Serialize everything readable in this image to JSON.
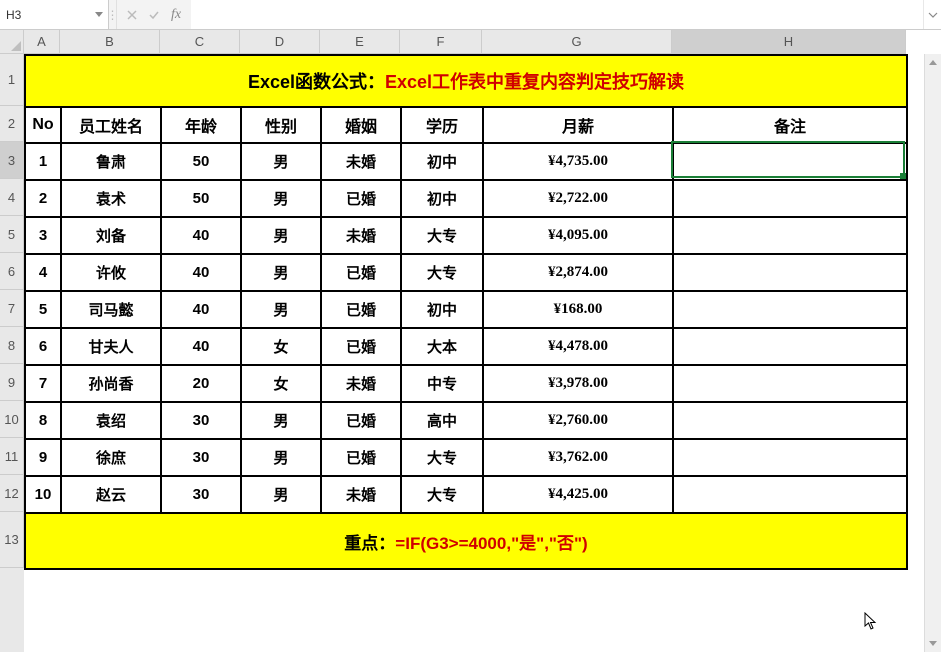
{
  "formula_bar": {
    "name_box": "H3",
    "formula": ""
  },
  "columns": [
    "A",
    "B",
    "C",
    "D",
    "E",
    "F",
    "G",
    "H"
  ],
  "active_col": "H",
  "active_row": 3,
  "row_numbers": [
    1,
    2,
    3,
    4,
    5,
    6,
    7,
    8,
    9,
    10,
    11,
    12,
    13
  ],
  "title": {
    "prefix": "Excel函数公式：",
    "main": "Excel工作表中重复内容判定技巧解读"
  },
  "headers": {
    "no": "No",
    "name": "员工姓名",
    "age": "年龄",
    "gender": "性别",
    "marital": "婚姻",
    "education": "学历",
    "salary": "月薪",
    "remark": "备注"
  },
  "rows": [
    {
      "no": "1",
      "name": "鲁肃",
      "age": "50",
      "gender": "男",
      "marital": "未婚",
      "education": "初中",
      "salary": "¥4,735.00",
      "remark": ""
    },
    {
      "no": "2",
      "name": "袁术",
      "age": "50",
      "gender": "男",
      "marital": "已婚",
      "education": "初中",
      "salary": "¥2,722.00",
      "remark": ""
    },
    {
      "no": "3",
      "name": "刘备",
      "age": "40",
      "gender": "男",
      "marital": "未婚",
      "education": "大专",
      "salary": "¥4,095.00",
      "remark": ""
    },
    {
      "no": "4",
      "name": "许攸",
      "age": "40",
      "gender": "男",
      "marital": "已婚",
      "education": "大专",
      "salary": "¥2,874.00",
      "remark": ""
    },
    {
      "no": "5",
      "name": "司马懿",
      "age": "40",
      "gender": "男",
      "marital": "已婚",
      "education": "初中",
      "salary": "¥168.00",
      "remark": ""
    },
    {
      "no": "6",
      "name": "甘夫人",
      "age": "40",
      "gender": "女",
      "marital": "已婚",
      "education": "大本",
      "salary": "¥4,478.00",
      "remark": ""
    },
    {
      "no": "7",
      "name": "孙尚香",
      "age": "20",
      "gender": "女",
      "marital": "未婚",
      "education": "中专",
      "salary": "¥3,978.00",
      "remark": ""
    },
    {
      "no": "8",
      "name": "袁绍",
      "age": "30",
      "gender": "男",
      "marital": "已婚",
      "education": "高中",
      "salary": "¥2,760.00",
      "remark": ""
    },
    {
      "no": "9",
      "name": "徐庶",
      "age": "30",
      "gender": "男",
      "marital": "已婚",
      "education": "大专",
      "salary": "¥3,762.00",
      "remark": ""
    },
    {
      "no": "10",
      "name": "赵云",
      "age": "30",
      "gender": "男",
      "marital": "未婚",
      "education": "大专",
      "salary": "¥4,425.00",
      "remark": ""
    }
  ],
  "footer": {
    "prefix": "重点：",
    "formula": "=IF(G3>=4000,\"是\",\"否\")"
  },
  "row_heights": {
    "title": 52,
    "header": 36,
    "data": 37,
    "footer": 56
  }
}
